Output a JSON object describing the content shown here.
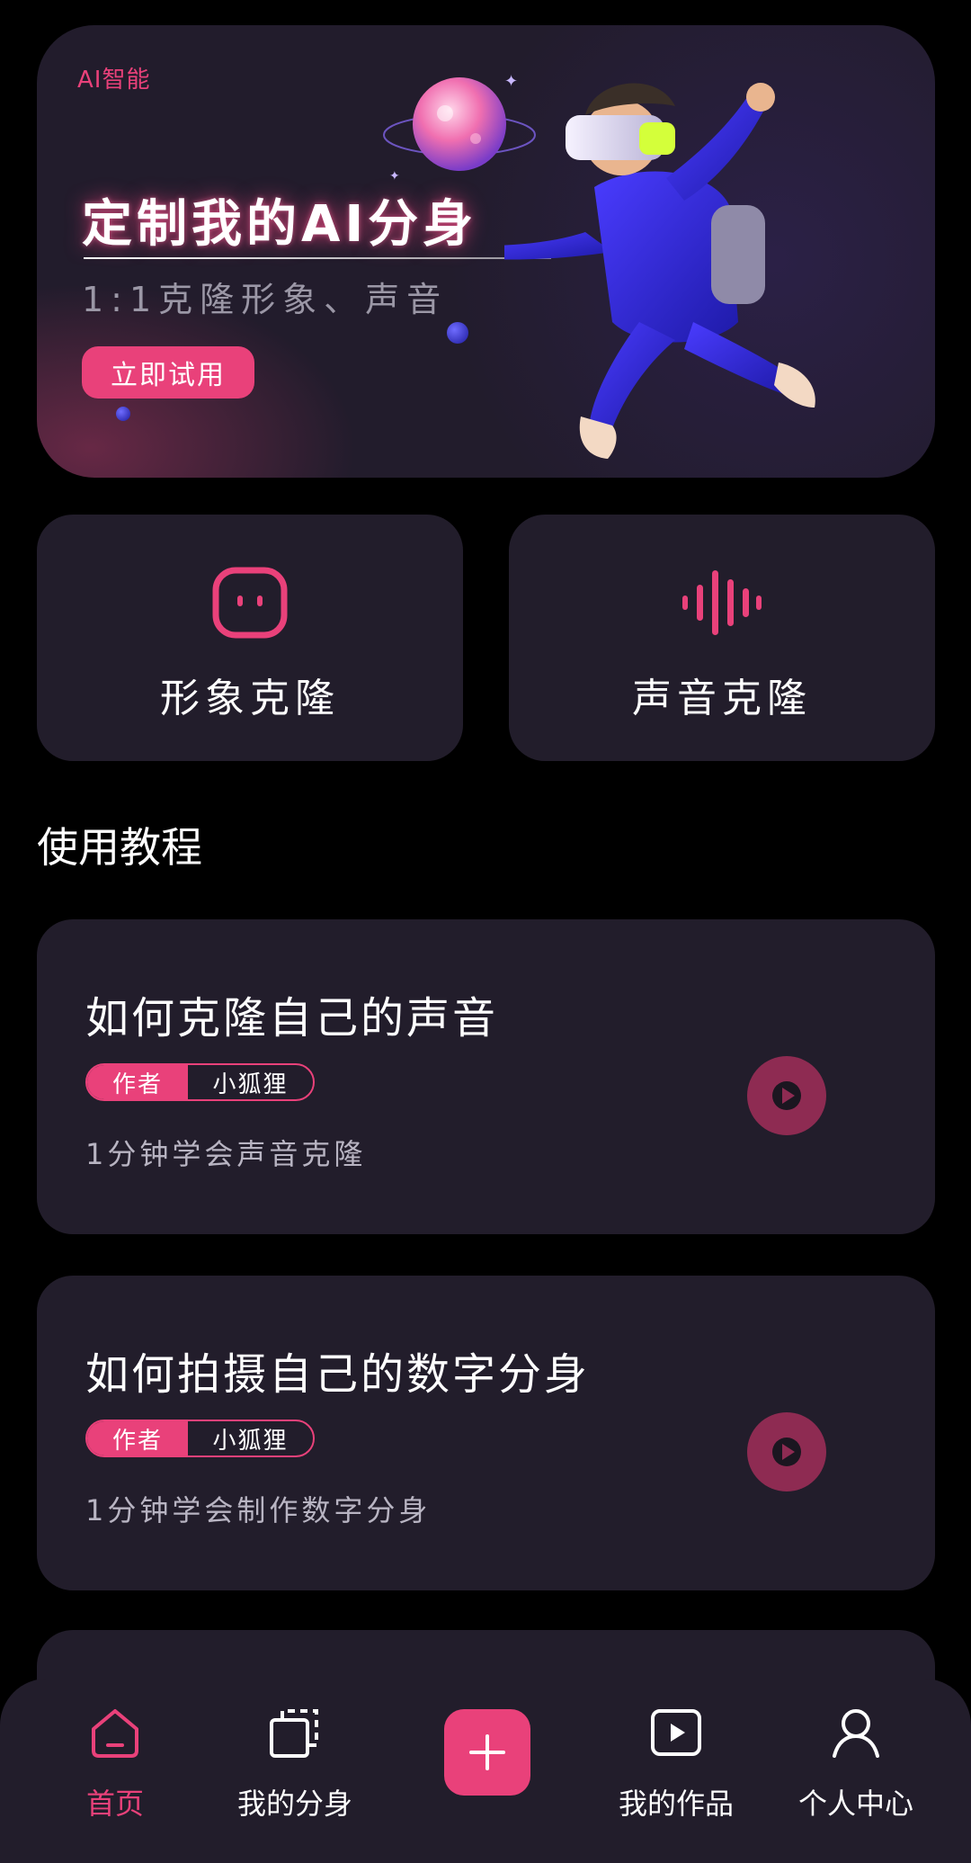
{
  "banner": {
    "tag": "AI智能",
    "title": "定制我的AI分身",
    "subtitle": "1:1克隆形象、声音",
    "button_label": "立即试用"
  },
  "features": [
    {
      "label": "形象克隆",
      "icon": "robot-face-icon"
    },
    {
      "label": "声音克隆",
      "icon": "sound-wave-icon"
    }
  ],
  "tutorials": {
    "section_title": "使用教程",
    "items": [
      {
        "title": "如何克隆自己的声音",
        "author_label": "作者",
        "author_name": "小狐狸",
        "description": "1分钟学会声音克隆"
      },
      {
        "title": "如何拍摄自己的数字分身",
        "author_label": "作者",
        "author_name": "小狐狸",
        "description": "1分钟学会制作数字分身"
      }
    ]
  },
  "tabbar": {
    "items": [
      {
        "label": "首页",
        "icon": "home-icon",
        "active": true
      },
      {
        "label": "我的分身",
        "icon": "avatar-copy-icon",
        "active": false
      },
      {
        "label": "",
        "icon": "plus-icon",
        "active": false
      },
      {
        "label": "我的作品",
        "icon": "video-play-icon",
        "active": false
      },
      {
        "label": "个人中心",
        "icon": "person-icon",
        "active": false
      }
    ]
  },
  "colors": {
    "accent": "#e9417a",
    "card": "#221d2b",
    "background": "#000000"
  }
}
